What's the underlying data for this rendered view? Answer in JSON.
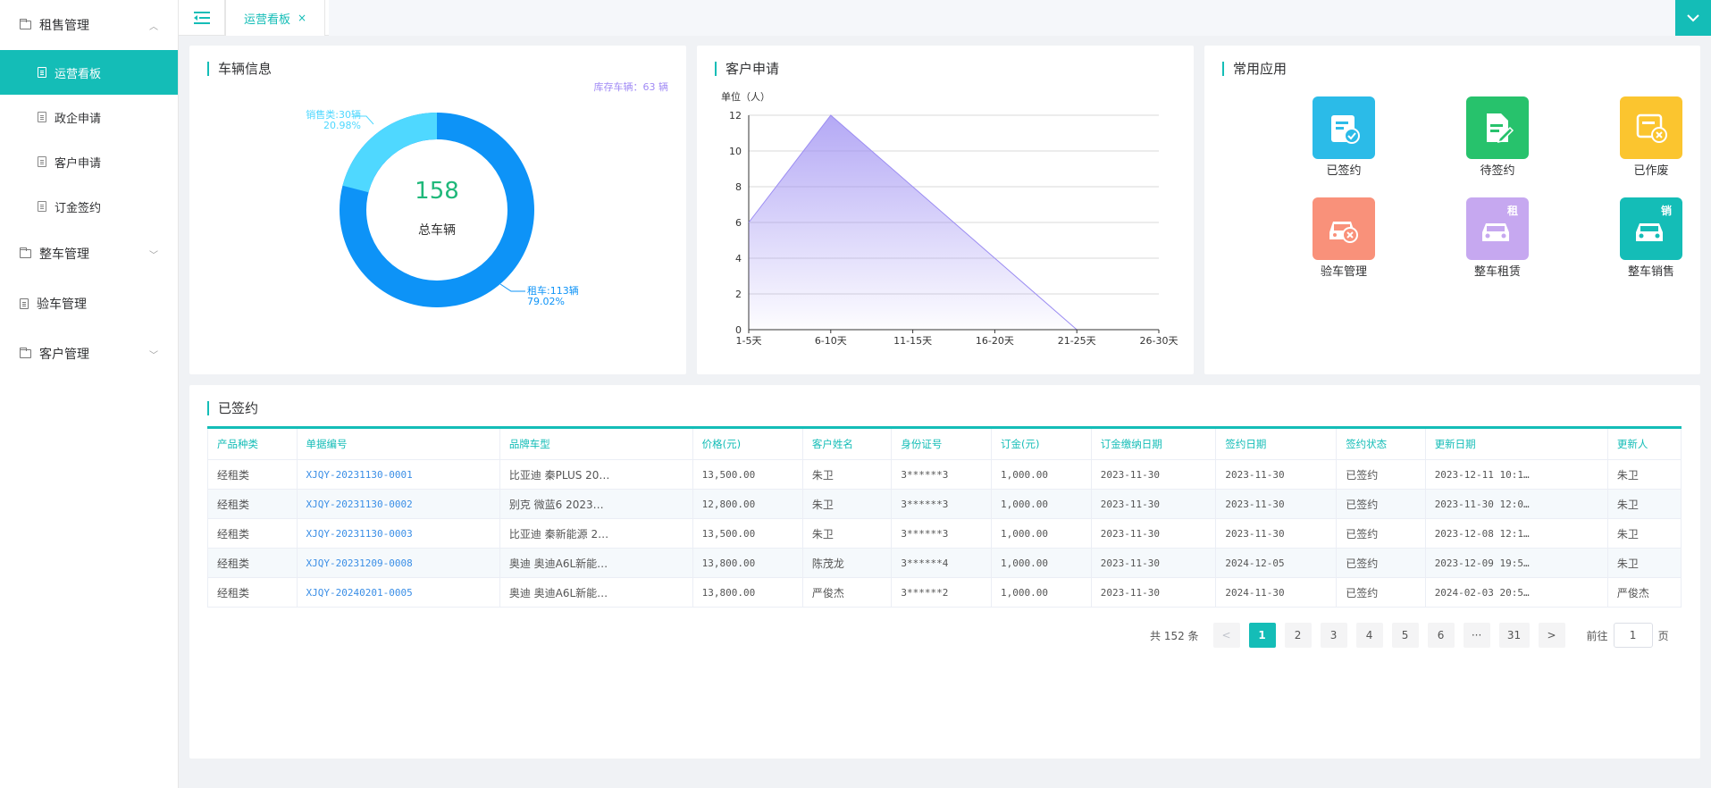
{
  "sidebar": {
    "groups": [
      {
        "label": "租售管理",
        "items": [
          "运营看板",
          "政企申请",
          "客户申请",
          "订金签约"
        ]
      },
      {
        "label": "整车管理"
      },
      {
        "label": "验车管理"
      },
      {
        "label": "客户管理"
      }
    ]
  },
  "topbar": {
    "tab_label": "运营看板",
    "tab_close": "×"
  },
  "vehicle_card": {
    "title": "车辆信息",
    "stock_note": "库存车辆：63 辆",
    "total_value": "158",
    "total_label": "总车辆",
    "sale_label_line1": "销售类:30辆",
    "sale_label_line2": "20.98%",
    "rent_label_line1": "租车:113辆",
    "rent_label_line2": "79.02%",
    "colors": {
      "rent": "#0d93f7",
      "sale": "#4fd8ff"
    }
  },
  "customer_card": {
    "title": "客户申请",
    "unit_label": "单位（人）"
  },
  "chart_data": {
    "type": "area",
    "title": "客户申请",
    "ylabel": "单位（人）",
    "categories": [
      "1-5天",
      "6-10天",
      "11-15天",
      "16-20天",
      "21-25天",
      "26-30天"
    ],
    "values": [
      6,
      12,
      8,
      4,
      0,
      0
    ],
    "ylim": [
      0,
      12
    ],
    "yticks": [
      0,
      2,
      4,
      6,
      8,
      10,
      12
    ],
    "grid": true,
    "color": "#9b8cf2"
  },
  "apps_card": {
    "title": "常用应用",
    "apps": [
      {
        "label": "已签约",
        "color": "#2bbbe8",
        "icon": "signed-contract-icon"
      },
      {
        "label": "待签约",
        "color": "#27c26c",
        "icon": "pending-contract-icon"
      },
      {
        "label": "已作废",
        "color": "#fbc52f",
        "icon": "voided-contract-icon"
      },
      {
        "label": "验车管理",
        "color": "#f9917a",
        "icon": "car-inspection-icon"
      },
      {
        "label": "整车租赁",
        "color": "#c6a8f0",
        "icon": "car-rent-icon",
        "badge": "租"
      },
      {
        "label": "整车销售",
        "color": "#14bdb7",
        "icon": "car-sale-icon",
        "badge": "销"
      }
    ]
  },
  "signed_card": {
    "title": "已签约",
    "columns": [
      "产品种类",
      "单据编号",
      "品牌车型",
      "价格(元)",
      "客户姓名",
      "身份证号",
      "订金(元)",
      "订金缴纳日期",
      "签约日期",
      "签约状态",
      "更新日期",
      "更新人"
    ],
    "rows": [
      [
        "经租类",
        "XJQY-20231130-0001",
        "比亚迪 秦PLUS 20…",
        "13,500.00",
        "朱卫",
        "3******3",
        "1,000.00",
        "2023-11-30",
        "2023-11-30",
        "已签约",
        "2023-12-11 10:1…",
        "朱卫"
      ],
      [
        "经租类",
        "XJQY-20231130-0002",
        "别克 微蓝6 2023…",
        "12,800.00",
        "朱卫",
        "3******3",
        "1,000.00",
        "2023-11-30",
        "2023-11-30",
        "已签约",
        "2023-11-30 12:0…",
        "朱卫"
      ],
      [
        "经租类",
        "XJQY-20231130-0003",
        "比亚迪 秦新能源 2…",
        "13,500.00",
        "朱卫",
        "3******3",
        "1,000.00",
        "2023-11-30",
        "2023-11-30",
        "已签约",
        "2023-12-08 12:1…",
        "朱卫"
      ],
      [
        "经租类",
        "XJQY-20231209-0008",
        "奥迪 奥迪A6L新能…",
        "13,800.00",
        "陈茂龙",
        "3******4",
        "1,000.00",
        "2023-11-30",
        "2024-12-05",
        "已签约",
        "2023-12-09 19:5…",
        "朱卫"
      ],
      [
        "经租类",
        "XJQY-20240201-0005",
        "奥迪 奥迪A6L新能…",
        "13,800.00",
        "严俊杰",
        "3******2",
        "1,000.00",
        "2023-11-30",
        "2024-11-30",
        "已签约",
        "2024-02-03 20:5…",
        "严俊杰"
      ]
    ]
  },
  "pagination": {
    "total_text": "共 152 条",
    "prev": "<",
    "pages": [
      "1",
      "2",
      "3",
      "4",
      "5",
      "6",
      "···",
      "31"
    ],
    "next": ">",
    "current": "1",
    "goto_prefix": "前往",
    "goto_value": "1",
    "goto_suffix": "页"
  }
}
